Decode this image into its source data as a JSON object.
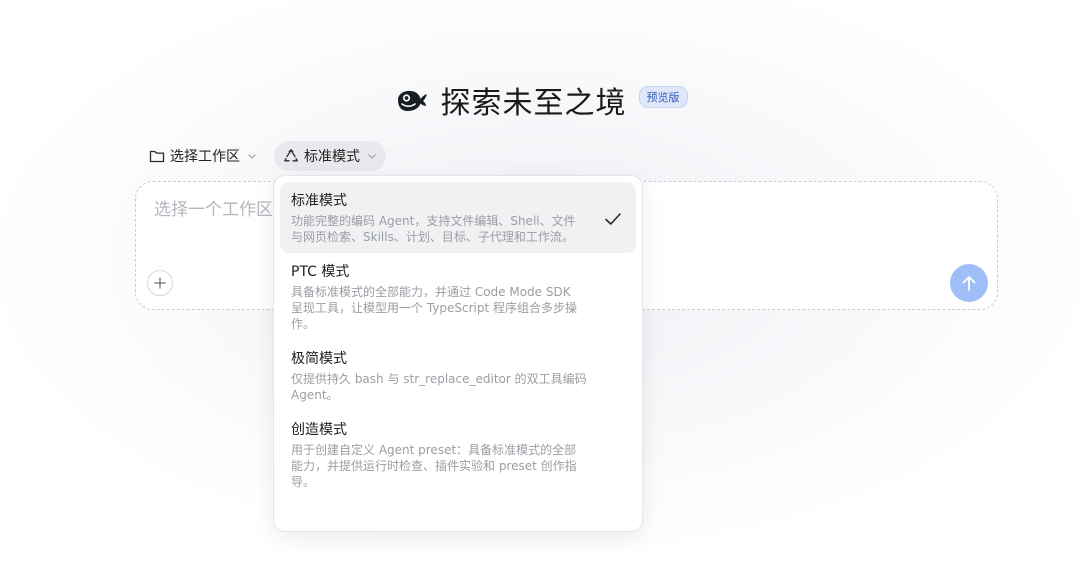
{
  "header": {
    "title": "探索未至之境",
    "badge": "预览版",
    "logo_icon": "whale-logo"
  },
  "toolbar": {
    "workspace_label": "选择工作区",
    "mode_label": "标准模式"
  },
  "composer": {
    "placeholder": "选择一个工作区"
  },
  "mode_menu": {
    "items": [
      {
        "title": "标准模式",
        "desc_lines": [
          "功能完整的编码 Agent，支持文件编辑、Shell、文件",
          "与网页检索、Skills、计划、目标、子代理和工作流。"
        ],
        "selected": true
      },
      {
        "title": "PTC 模式",
        "desc_lines": [
          "具备标准模式的全部能力，并通过 Code Mode SDK",
          "呈现工具，让模型用一个 TypeScript 程序组合多步操",
          "作。"
        ],
        "selected": false
      },
      {
        "title": "极简模式",
        "desc_lines": [
          "仅提供持久 bash 与 str_replace_editor 的双工具编码",
          "Agent。"
        ],
        "selected": false
      },
      {
        "title": "创造模式",
        "desc_lines": [
          "用于创建自定义 Agent preset：具备标准模式的全部",
          "能力，并提供运行时检查、插件实验和 preset 创作指",
          "导。"
        ],
        "selected": false
      }
    ]
  },
  "colors": {
    "accent": "#9fbdf6",
    "badge_bg": "#dfe8fb",
    "badge_text": "#3a5bb5",
    "selected_bg": "#f0f1f3"
  }
}
